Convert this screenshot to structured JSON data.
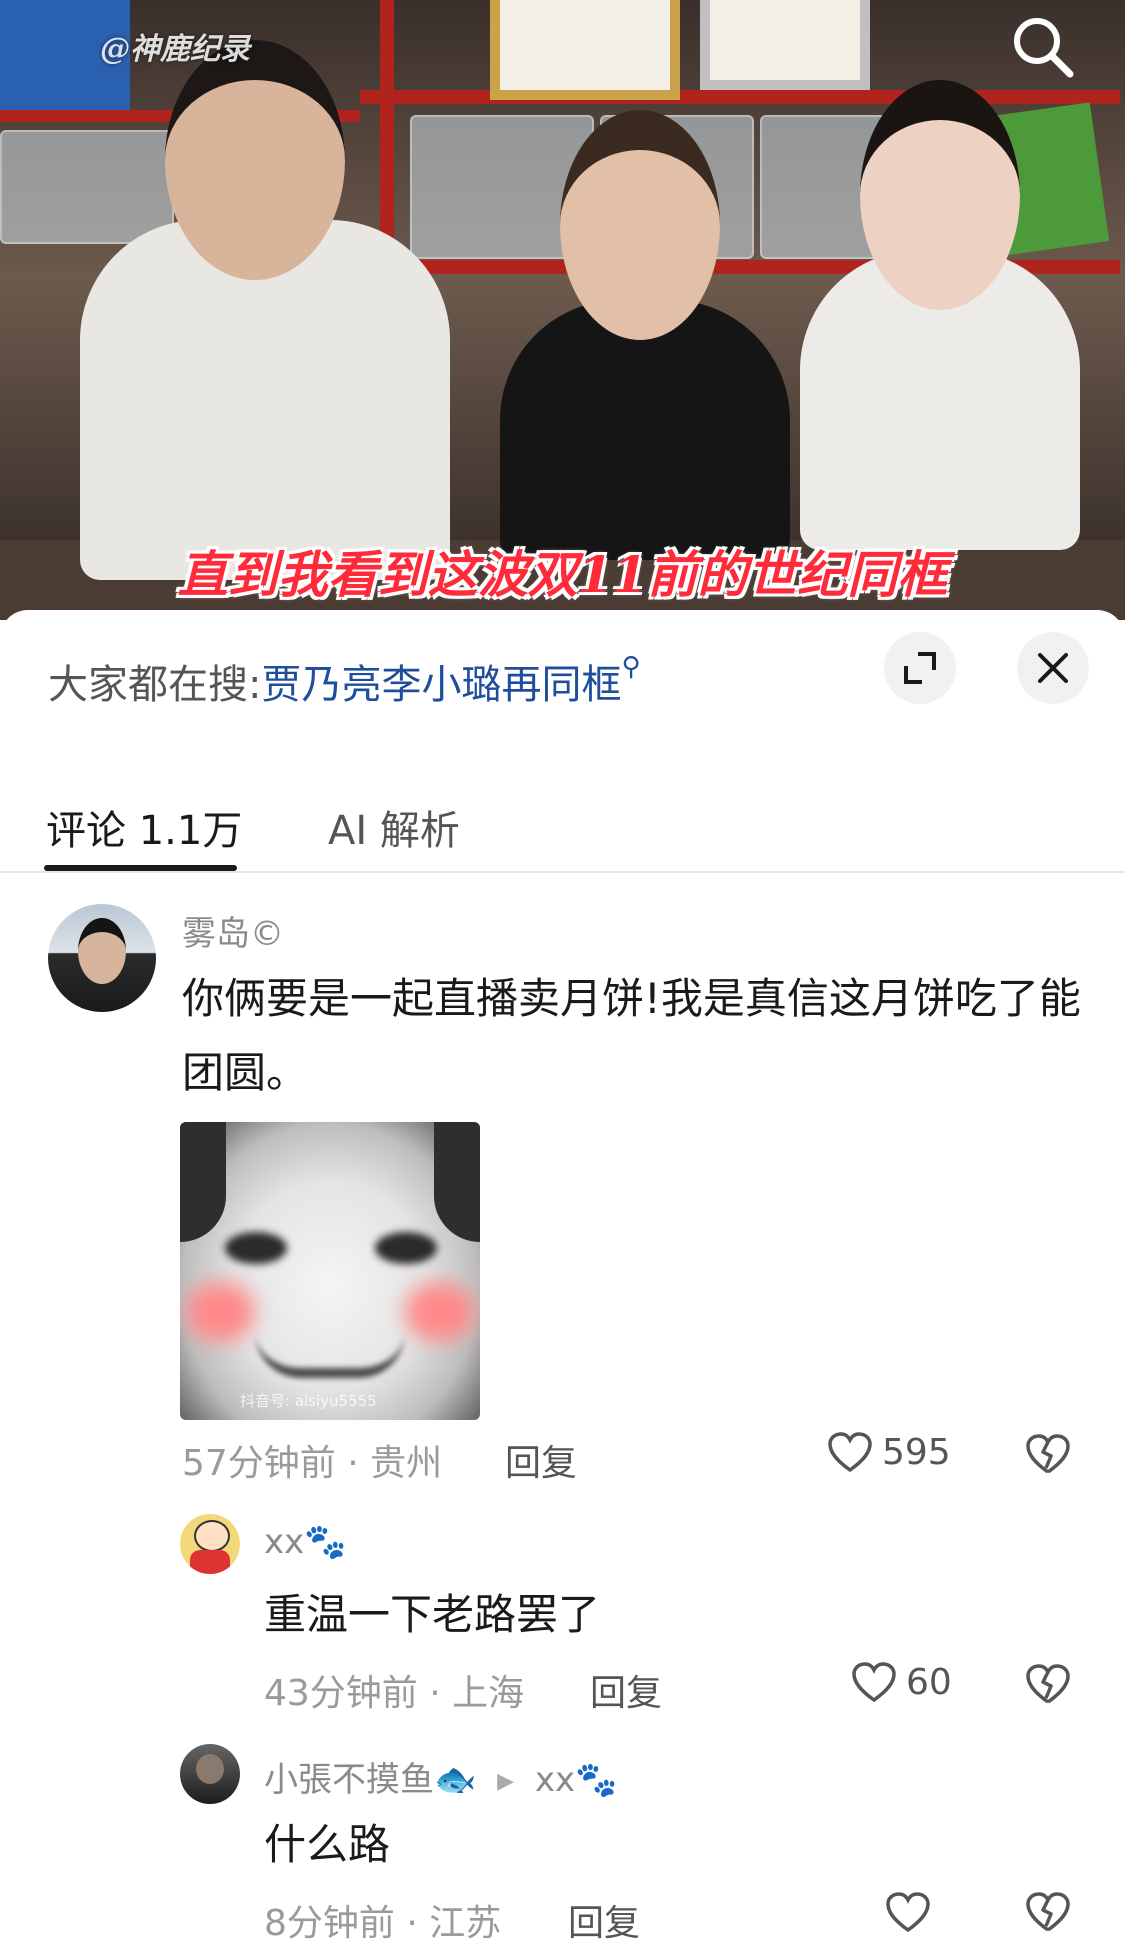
{
  "video": {
    "watermark": "@神鹿纪录",
    "subtitle": "直到我看到这波双11前的世纪同框"
  },
  "hot_search": {
    "prefix": "大家都在搜:",
    "keyword": "贾乃亮李小璐再同框"
  },
  "tabs": [
    {
      "label": "评论 1.1万",
      "active": true
    },
    {
      "label": "AI 解析",
      "active": false
    }
  ],
  "comments": [
    {
      "username": "雾岛©",
      "text": "你俩要是一起直播卖月饼!我是真信这月饼吃了能团圆。",
      "meta": "57分钟前 · 贵州",
      "reply_label": "回复",
      "likes": "595",
      "sticker_watermark": "抖音号: aisiyu5555"
    },
    {
      "username": "xx🐾",
      "text": "重温一下老路罢了",
      "meta": "43分钟前 · 上海",
      "reply_label": "回复",
      "likes": "60"
    },
    {
      "username": "小張不摸鱼🐟",
      "reply_to": "xx🐾",
      "text": "什么路",
      "meta": "8分钟前 · 江苏",
      "reply_label": "回复"
    }
  ],
  "colors": {
    "accent_link": "#1e4e9c",
    "subtitle_red": "#ff2b3a",
    "shelf_red": "#b0241d"
  }
}
